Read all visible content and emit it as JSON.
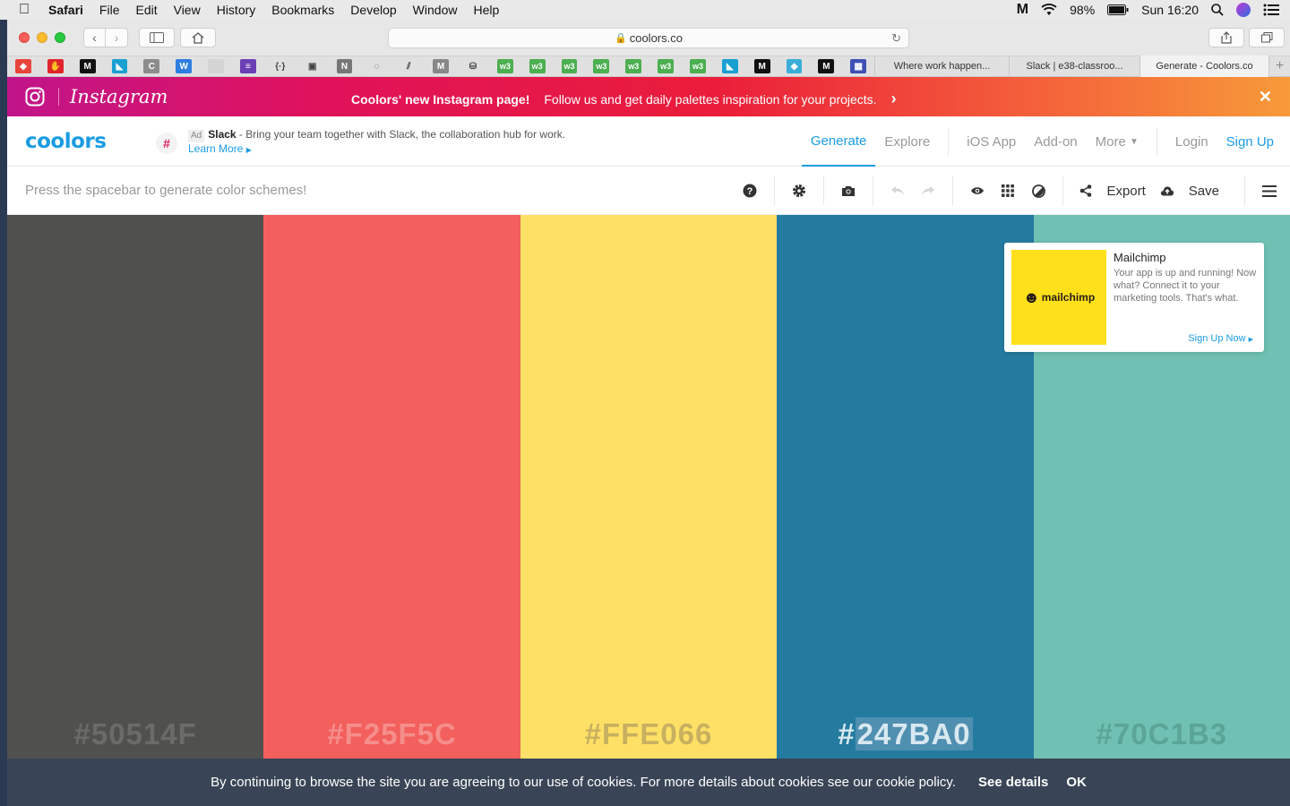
{
  "menubar": {
    "app": "Safari",
    "items": [
      "File",
      "Edit",
      "View",
      "History",
      "Bookmarks",
      "Develop",
      "Window",
      "Help"
    ],
    "battery": "98%",
    "clock": "Sun 16:20"
  },
  "browser": {
    "url": "coolors.co",
    "tabs": [
      "Where work happen...",
      "Slack | e38-classroo...",
      "Generate - Coolors.co"
    ],
    "favorites": [
      {
        "icon": "red-diamond-icon",
        "color": "#e8453c",
        "glyph": "◆"
      },
      {
        "icon": "red-hand-icon",
        "color": "#e0262d",
        "glyph": "✋"
      },
      {
        "icon": "medium-icon",
        "color": "#111111",
        "glyph": "M"
      },
      {
        "icon": "blue-bird-icon",
        "color": "#1a9fd1",
        "glyph": "◣"
      },
      {
        "icon": "c-icon",
        "color": "#8c8c8c",
        "glyph": "C"
      },
      {
        "icon": "w-circle-icon",
        "color": "#2e7de0",
        "glyph": "W"
      },
      {
        "icon": "blank-page-icon",
        "color": "#d4d4d4",
        "glyph": ""
      },
      {
        "icon": "purple-list-icon",
        "color": "#6b3fb5",
        "glyph": "≡"
      },
      {
        "icon": "curly-braces-icon",
        "color": "#e1e0e1",
        "glyph": "{·}"
      },
      {
        "icon": "book-icon",
        "color": "#e1e0e1",
        "glyph": "▣"
      },
      {
        "icon": "n-icon",
        "color": "#777777",
        "glyph": "N"
      },
      {
        "icon": "red-ring-icon",
        "color": "#e1e0e1",
        "glyph": "◌"
      },
      {
        "icon": "stripes-icon",
        "color": "#e1e0e1",
        "glyph": "⫽"
      },
      {
        "icon": "m-gray-icon",
        "color": "#888888",
        "glyph": "M"
      },
      {
        "icon": "database-icon",
        "color": "#e1e0e1",
        "glyph": "⛁"
      },
      {
        "icon": "w3-icon",
        "color": "#4caf50",
        "glyph": "w3"
      },
      {
        "icon": "w3-icon",
        "color": "#4caf50",
        "glyph": "w3"
      },
      {
        "icon": "w3-icon",
        "color": "#4caf50",
        "glyph": "w3"
      },
      {
        "icon": "w3-icon",
        "color": "#4caf50",
        "glyph": "w3"
      },
      {
        "icon": "w3-icon",
        "color": "#4caf50",
        "glyph": "w3"
      },
      {
        "icon": "w3-icon",
        "color": "#4caf50",
        "glyph": "w3"
      },
      {
        "icon": "w3-icon",
        "color": "#4caf50",
        "glyph": "w3"
      },
      {
        "icon": "blue-bird-icon",
        "color": "#1a9fd1",
        "glyph": "◣"
      },
      {
        "icon": "medium-icon",
        "color": "#111111",
        "glyph": "M"
      },
      {
        "icon": "cube-icon",
        "color": "#3aaed8",
        "glyph": "◆"
      },
      {
        "icon": "medium-icon",
        "color": "#111111",
        "glyph": "M"
      },
      {
        "icon": "layout-icon",
        "color": "#3f51b5",
        "glyph": "▦"
      }
    ]
  },
  "banner": {
    "brand": "Instagram",
    "headline": "Coolors' new Instagram page!",
    "message": "Follow us and get daily palettes inspiration for your projects."
  },
  "header": {
    "logo": "coolors",
    "ad": {
      "badge": "Ad",
      "sponsor": "Slack",
      "text": " - Bring your team together with Slack, the collaboration hub for work.",
      "link": "Learn More"
    },
    "nav": {
      "generate": "Generate",
      "explore": "Explore",
      "ios": "iOS App",
      "addon": "Add-on",
      "more": "More",
      "login": "Login",
      "signup": "Sign Up"
    }
  },
  "appbar": {
    "hint": "Press the spacebar to generate color schemes!",
    "export": "Export",
    "save": "Save"
  },
  "palette": [
    {
      "hex": "#50514F",
      "color": "#50514f",
      "text_color": "#6b6b69"
    },
    {
      "hex": "#F25F5C",
      "color": "#f25f5c",
      "text_color": "#f58e8b"
    },
    {
      "hex": "#FFE066",
      "color": "#ffe066",
      "text_color": "#c8b060"
    },
    {
      "hex": "#247BA0",
      "color": "#247ba0",
      "text_color": "#d8e8f0"
    },
    {
      "hex": "#70C1B3",
      "color": "#70c1b3",
      "text_color": "#5aa597"
    }
  ],
  "sidead": {
    "image_label": "mailchimp",
    "title": "Mailchimp",
    "description": "Your app is up and running! Now what? Connect it to your marketing tools. That's what.",
    "cta": "Sign Up Now"
  },
  "cookie": {
    "text": "By continuing to browse the site you are agreeing to our use of cookies. For more details about cookies see our cookie policy.",
    "details": "See details",
    "ok": "OK"
  }
}
